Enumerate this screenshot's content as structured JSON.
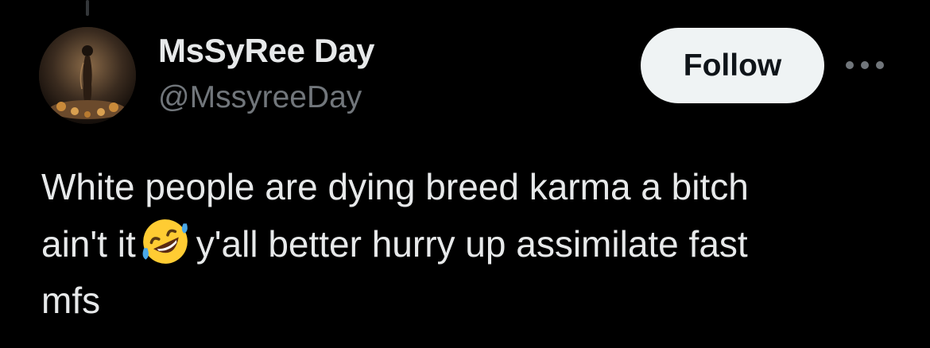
{
  "author": {
    "display_name": "MsSyRee Day",
    "handle": "@MssyreeDay"
  },
  "actions": {
    "follow_label": "Follow",
    "more_icon": "more-horizontal-icon"
  },
  "tweet": {
    "line1": "White people are dying breed karma a bitch",
    "line2_before": "ain't it",
    "emoji": "rolling-on-floor-laughing-emoji",
    "line2_after": "y'all better hurry up assimilate fast",
    "line3": "mfs"
  },
  "colors": {
    "background": "#000000",
    "primary_text": "#e7e9ea",
    "secondary_text": "#71767b",
    "follow_bg": "#eff3f4",
    "follow_text": "#0f1419"
  }
}
